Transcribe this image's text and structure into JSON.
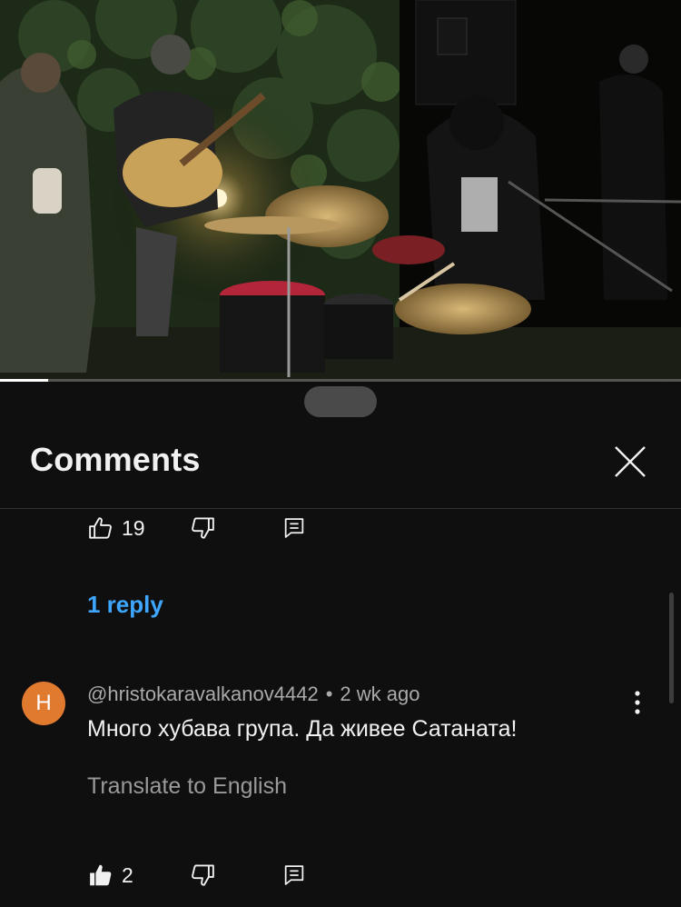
{
  "video": {
    "progress_fraction": 0.07
  },
  "sheet": {
    "title": "Comments"
  },
  "previous_comment": {
    "like_count": "19",
    "reply_link": "1 reply"
  },
  "comment": {
    "avatar_letter": "H",
    "author": "@hristokaravalkanov4442",
    "separator": "•",
    "time": "2 wk ago",
    "text": "Много хубава група. Да живее Сатаната!",
    "translate_label": "Translate to English",
    "like_count": "2"
  },
  "colors": {
    "background": "#0f0f0f",
    "accent_link": "#3ea6ff",
    "avatar": "#e07a2f",
    "secondary_text": "#aaaaaa"
  },
  "icons": {
    "like": "thumbs-up-icon",
    "like_filled": "thumbs-up-filled-icon",
    "dislike": "thumbs-down-icon",
    "reply": "comment-reply-icon",
    "close": "close-icon",
    "more": "more-vert-icon"
  }
}
